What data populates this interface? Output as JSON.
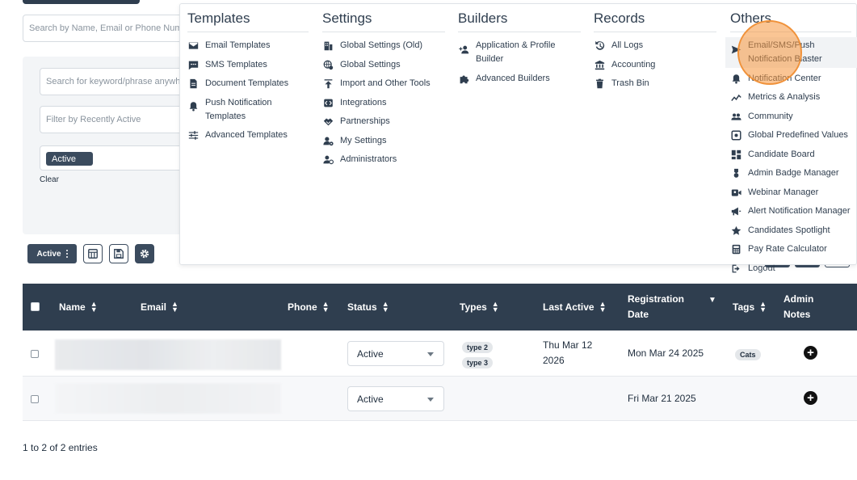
{
  "background": {
    "search_placeholder": "Search by Name, Email or Phone Number",
    "keyword_placeholder": "Search for keyword/phrase anywhere",
    "recent_placeholder": "Filter by Recently Active",
    "status_filter_chip": "Active",
    "clear_label": "Clear",
    "toolbar_active_label": "Active"
  },
  "menu": {
    "templates": {
      "title": "Templates",
      "items": [
        {
          "label": "Email Templates",
          "icon": "envelope-icon"
        },
        {
          "label": "SMS Templates",
          "icon": "sms-icon"
        },
        {
          "label": "Document Templates",
          "icon": "document-icon"
        },
        {
          "label": "Push Notification Templates",
          "icon": "bell-icon"
        },
        {
          "label": "Advanced Templates",
          "icon": "sliders-icon"
        }
      ]
    },
    "settings": {
      "title": "Settings",
      "items": [
        {
          "label": "Global Settings (Old)",
          "icon": "building-icon"
        },
        {
          "label": "Global Settings",
          "icon": "globe-gear-icon"
        },
        {
          "label": "Import and Other Tools",
          "icon": "upload-icon"
        },
        {
          "label": "Integrations",
          "icon": "code-icon"
        },
        {
          "label": "Partnerships",
          "icon": "handshake-icon"
        },
        {
          "label": "My Settings",
          "icon": "user-gear-icon"
        },
        {
          "label": "Administrators",
          "icon": "admin-icon"
        }
      ]
    },
    "builders": {
      "title": "Builders",
      "items": [
        {
          "label": "Application & Profile Builder",
          "icon": "user-plus-icon"
        },
        {
          "label": "Advanced Builders",
          "icon": "puzzle-icon"
        }
      ]
    },
    "records": {
      "title": "Records",
      "items": [
        {
          "label": "All Logs",
          "icon": "history-icon"
        },
        {
          "label": "Accounting",
          "icon": "bank-icon"
        },
        {
          "label": "Trash Bin",
          "icon": "trash-icon"
        }
      ]
    },
    "others": {
      "title": "Others",
      "items": [
        {
          "label": "Email/SMS/Push Notification Blaster",
          "icon": "send-icon"
        },
        {
          "label": "Notification Center",
          "icon": "bell-alert-icon"
        },
        {
          "label": "Metrics & Analysis",
          "icon": "chart-line-icon"
        },
        {
          "label": "Community",
          "icon": "group-icon"
        },
        {
          "label": "Global Predefined Values",
          "icon": "plus-box-icon"
        },
        {
          "label": "Candidate Board",
          "icon": "dashboard-icon"
        },
        {
          "label": "Admin Badge Manager",
          "icon": "badge-icon"
        },
        {
          "label": "Webinar Manager",
          "icon": "video-icon"
        },
        {
          "label": "Alert Notification Manager",
          "icon": "megaphone-icon"
        },
        {
          "label": "Candidates Spotlight",
          "icon": "star-icon"
        },
        {
          "label": "Pay Rate Calculator",
          "icon": "calculator-icon"
        },
        {
          "label": "Logout",
          "icon": "logout-icon"
        }
      ]
    }
  },
  "table": {
    "headers": [
      "Name",
      "Email",
      "Phone",
      "Status",
      "Types",
      "Last Active",
      "Registration Date",
      "Tags",
      "Admin Notes"
    ],
    "rows": [
      {
        "status": "Active",
        "types": [
          "type 2",
          "type 3"
        ],
        "last_active": "Thu Mar 12 2026",
        "registration": "Mon Mar 24 2025",
        "tags": [
          "Cats"
        ]
      },
      {
        "status": "Active",
        "types": [],
        "last_active": "",
        "registration": "Fri Mar 21 2025",
        "tags": []
      }
    ],
    "footer": "1 to 2 of 2 entries"
  }
}
